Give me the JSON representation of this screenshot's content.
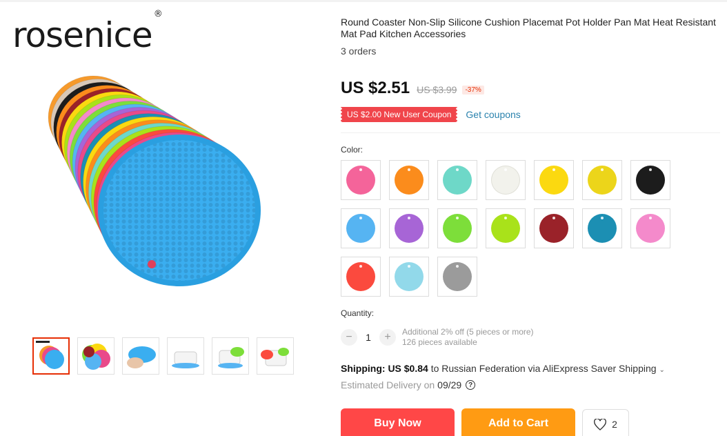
{
  "brand": {
    "logo_text": "rosenice",
    "registered": "®"
  },
  "product": {
    "title": "Round Coaster Non-Slip Silicone Cushion Placemat Pot Holder Pan Mat Heat Resistant Mat Pad Kitchen Accessories",
    "orders": "3 orders"
  },
  "price": {
    "current": "US $2.51",
    "original": "US $3.99",
    "discount": "-37%"
  },
  "coupon": {
    "badge": "US $2.00 New User Coupon",
    "link": "Get coupons"
  },
  "color": {
    "label": "Color:",
    "swatches": [
      "#f4649a",
      "#fb8c1c",
      "#6ed8c8",
      "#f2f2ec",
      "#fbd910",
      "#ecd51a",
      "#1c1c1c",
      "#56b4f2",
      "#a765d6",
      "#7dde3a",
      "#a9e21a",
      "#9a2229",
      "#1c8fb3",
      "#f48acb",
      "#fb4a3e",
      "#92d9ea",
      "#9b9b9b"
    ]
  },
  "quantity": {
    "label": "Quantity:",
    "value": "1",
    "minus": "−",
    "plus": "+",
    "note_1": "Additional 2% off (5 pieces or more)",
    "note_2": "126 pieces available"
  },
  "shipping": {
    "label": "Shipping:",
    "price": "US $0.84",
    "rest": "to Russian Federation via AliExpress Saver Shipping",
    "chevron": "⌄",
    "delivery_prefix": "Estimated Delivery on",
    "delivery_date": "09/29",
    "help_glyph": "?"
  },
  "actions": {
    "buy_now": "Buy Now",
    "add_to_cart": "Add to Cart",
    "wishlist_count": "2"
  },
  "icons": {
    "heart": "heart-icon",
    "help": "question-circle-icon",
    "chevron": "chevron-down-icon"
  },
  "colors": {
    "accent_red": "#ff4747",
    "accent_orange": "#ff9b13",
    "link_blue": "#2a82ad"
  }
}
